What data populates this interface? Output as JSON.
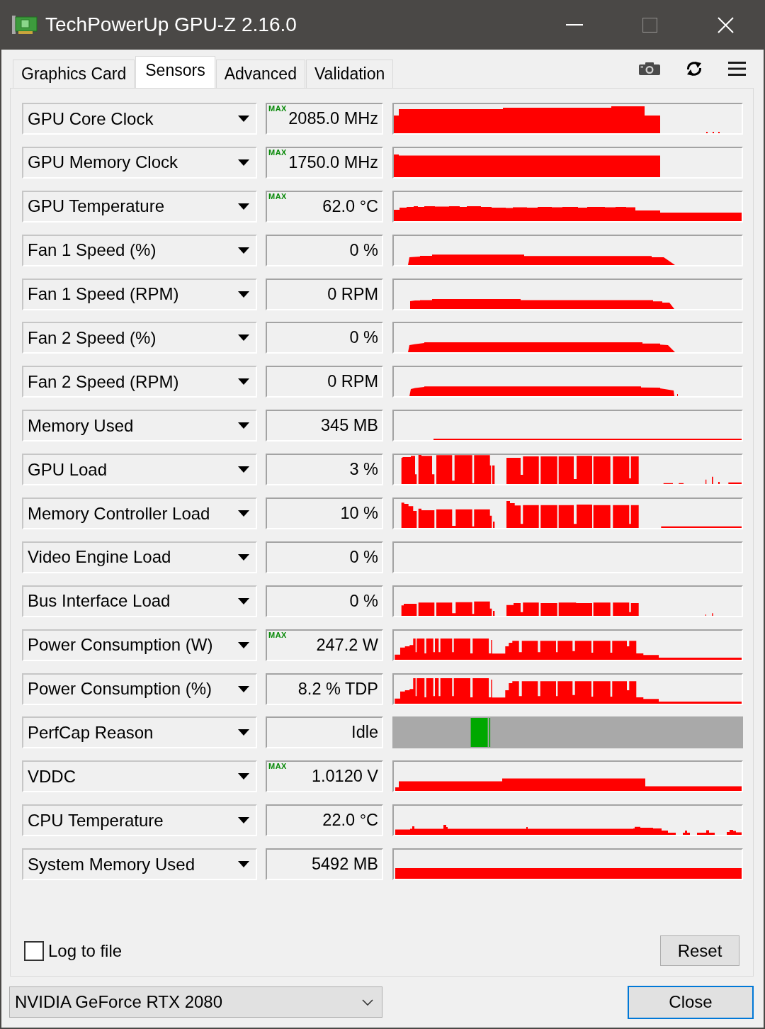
{
  "window": {
    "title": "TechPowerUp GPU-Z 2.16.0",
    "maximize_disabled": true
  },
  "tabs": [
    {
      "label": "Graphics Card",
      "selected": false
    },
    {
      "label": "Sensors",
      "selected": true
    },
    {
      "label": "Advanced",
      "selected": false
    },
    {
      "label": "Validation",
      "selected": false
    }
  ],
  "sensors": [
    {
      "name": "GPU Core Clock",
      "reading": "2085.0 MHz",
      "badge": "MAX",
      "kind": "graph"
    },
    {
      "name": "GPU Memory Clock",
      "reading": "1750.0 MHz",
      "badge": "MAX",
      "kind": "graph"
    },
    {
      "name": "GPU Temperature",
      "reading": "62.0 °C",
      "badge": "MAX",
      "kind": "graph"
    },
    {
      "name": "Fan 1 Speed (%)",
      "reading": "0 %",
      "kind": "graph"
    },
    {
      "name": "Fan 1 Speed (RPM)",
      "reading": "0 RPM",
      "kind": "graph"
    },
    {
      "name": "Fan 2 Speed (%)",
      "reading": "0 %",
      "kind": "graph"
    },
    {
      "name": "Fan 2 Speed (RPM)",
      "reading": "0 RPM",
      "kind": "graph"
    },
    {
      "name": "Memory Used",
      "reading": "345 MB",
      "kind": "graph"
    },
    {
      "name": "GPU Load",
      "reading": "3 %",
      "kind": "graph"
    },
    {
      "name": "Memory Controller Load",
      "reading": "10 %",
      "kind": "graph"
    },
    {
      "name": "Video Engine Load",
      "reading": "0 %",
      "kind": "graph"
    },
    {
      "name": "Bus Interface Load",
      "reading": "0 %",
      "kind": "graph"
    },
    {
      "name": "Power Consumption (W)",
      "reading": "247.2 W",
      "badge": "MAX",
      "kind": "graph"
    },
    {
      "name": "Power Consumption (%)",
      "reading": "8.2 % TDP",
      "kind": "graph"
    },
    {
      "name": "PerfCap Reason",
      "reading": "Idle",
      "kind": "perfcap"
    },
    {
      "name": "VDDC",
      "reading": "1.0120 V",
      "badge": "MAX",
      "kind": "graph"
    },
    {
      "name": "CPU Temperature",
      "reading": "22.0 °C",
      "kind": "graph"
    },
    {
      "name": "System Memory Used",
      "reading": "5492 MB",
      "kind": "graph"
    }
  ],
  "log_to_file": {
    "label": "Log to file",
    "checked": false
  },
  "reset_button": {
    "label": "Reset"
  },
  "gpu_select": {
    "value": "NVIDIA GeForce RTX 2080"
  },
  "close_button": {
    "label": "Close",
    "focused": true
  }
}
